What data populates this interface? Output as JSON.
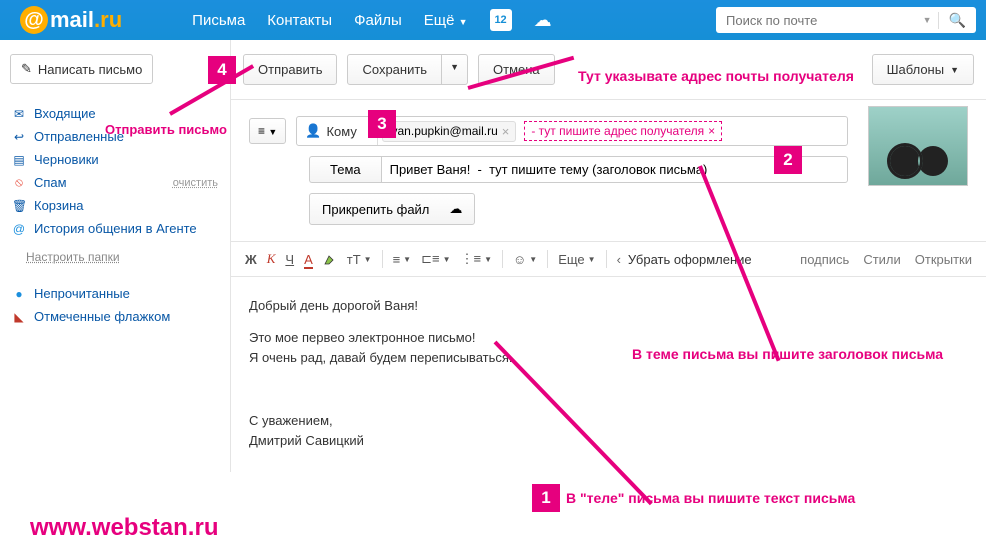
{
  "brand": {
    "mail": "mail",
    "ru": ".ru"
  },
  "topnav": {
    "letters": "Письма",
    "contacts": "Контакты",
    "files": "Файлы",
    "more": "Ещё",
    "cal_day": "12"
  },
  "search": {
    "placeholder": "Поиск по почте"
  },
  "sidebar": {
    "compose": "Написать письмо",
    "inbox": "Входящие",
    "sent": "Отправленные",
    "drafts": "Черновики",
    "spam": "Спам",
    "clear": "очистить",
    "trash": "Корзина",
    "agent": "История общения в Агенте",
    "config": "Настроить папки",
    "unread": "Непрочитанные",
    "flagged": "Отмеченные флажком"
  },
  "toolbar": {
    "send": "Отправить",
    "save": "Сохранить",
    "cancel": "Отмена",
    "templates": "Шаблоны"
  },
  "compose": {
    "to_label": "Кому",
    "to_chip": "ivan.pupkin@mail.ru",
    "to_placeholder": "- тут пишите адрес получателя",
    "subject_label": "Тема",
    "subject_value": "Привет Ваня!  -  тут пишите тему (заголовок письма)",
    "attach": "Прикрепить файл"
  },
  "editor": {
    "bold": "Ж",
    "italic": "К",
    "underline": "Ч",
    "color": "А",
    "size": "тТ",
    "smile": "☺",
    "more": "Еще",
    "remove_fmt": "Убрать оформление",
    "signature": "подпись",
    "styles": "Стили",
    "cards": "Открытки"
  },
  "body": {
    "greeting": "Добрый день дорогой Ваня!",
    "line1": "Это мое первео электронное письмо!",
    "line2": "Я очень рад, давай будем переписываться.",
    "sign1": "С уважением,",
    "sign2": "Дмитрий Савицкий"
  },
  "annotations": {
    "n1": "1",
    "t1": "В \"теле\" письма вы пишите текст письма",
    "n2": "2",
    "t2": "В теме письма вы пишите заголовок письма",
    "n3": "3",
    "n4": "4",
    "t4": "Отправить письмо",
    "t_top": "Тут указывате адрес почты получателя",
    "watermark": "www.webstan.ru"
  }
}
